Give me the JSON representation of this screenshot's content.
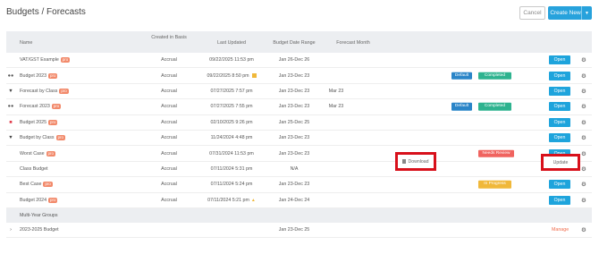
{
  "breadcrumb": "Budgets / Forecasts",
  "toolbar": {
    "cancel": "Cancel",
    "create_new": "Create New",
    "create_caret": "▼"
  },
  "columns": {
    "name": "Name",
    "basis": "Created in Basis",
    "updated": "Last Updated",
    "range": "Budget Date Range",
    "month": "Forecast Month"
  },
  "rows": [
    {
      "icon": "",
      "name": "VAT/GST Example",
      "pro": "pro",
      "basis": "Accrual",
      "updated": "09/22/2025 11:53 pm",
      "range": "Jan 26-Dec 26",
      "month": "",
      "action": "Open"
    },
    {
      "icon": "users-icon",
      "name": "Budget 2023",
      "pro": "pro",
      "basis": "Accrual",
      "updated": "09/22/2025 8:50 pm",
      "range": "Jan 23-Dec 23",
      "month": "",
      "badge1": "Default",
      "badge2": "Completed",
      "action": "Open"
    },
    {
      "icon": "filter-icon",
      "name": "Forecast by Class",
      "pro": "pro",
      "basis": "Accrual",
      "updated": "07/27/2025 7:57 pm",
      "range": "Jan 23-Dec 23",
      "month": "Mar 23",
      "action": "Open"
    },
    {
      "icon": "users-icon",
      "name": "Forecast 2023",
      "pro": "pro",
      "basis": "Accrual",
      "updated": "07/27/2025 7:55 pm",
      "range": "Jan 23-Dec 23",
      "month": "Mar 23",
      "badge1": "Default",
      "badge2": "Completed",
      "action": "Open"
    },
    {
      "icon": "lock-icon",
      "name": "Budget 2025",
      "pro": "pro",
      "basis": "Accrual",
      "updated": "02/10/2025 9:26 pm",
      "range": "Jan 25-Dec 25",
      "month": "",
      "action": "Open"
    },
    {
      "icon": "filter-icon",
      "name": "Budget by Class",
      "pro": "pro",
      "basis": "Accrual",
      "updated": "11/24/2024 4:48 pm",
      "range": "Jan 23-Dec 23",
      "month": "",
      "action": "Open"
    },
    {
      "icon": "",
      "name": "Worst Case",
      "pro": "pro",
      "basis": "Accrual",
      "updated": "07/31/2024 11:53 pm",
      "range": "Jan 23-Dec 23",
      "month": "",
      "badge2": "Needs Review",
      "action": "Open"
    },
    {
      "icon": "",
      "name": "Class Budget",
      "pro": "",
      "basis": "Accrual",
      "updated": "07/11/2024 5:31 pm",
      "range": "N/A",
      "month": "",
      "download": "Download",
      "action": "Update"
    },
    {
      "icon": "",
      "name": "Best Case",
      "pro": "pro",
      "basis": "Accrual",
      "updated": "07/11/2024 5:24 pm",
      "range": "Jan 23-Dec 23",
      "month": "",
      "badge2": "In Progress",
      "action": "Open"
    },
    {
      "icon": "",
      "name": "Budget 2024",
      "pro": "pro",
      "basis": "Accrual",
      "updated": "07/11/2024 5:21 pm",
      "range": "Jan 24-Dec 24",
      "month": "",
      "action": "Open"
    }
  ],
  "group_header": "Multi-Year Groups",
  "group_row": {
    "expander": "›",
    "name": "2023-2025 Budget",
    "range": "Jan 23-Dec 25",
    "action": "Manage"
  },
  "gear_glyph": "⚙",
  "colors": {
    "primary": "#1ea4dc",
    "default_badge": "#2a85c8",
    "completed": "#2eb38f",
    "needs_review": "#f0635f",
    "in_progress": "#f0b83a",
    "pro_tag": "#f28a6b",
    "highlight": "#d8101b",
    "manage": "#f06a4a"
  }
}
